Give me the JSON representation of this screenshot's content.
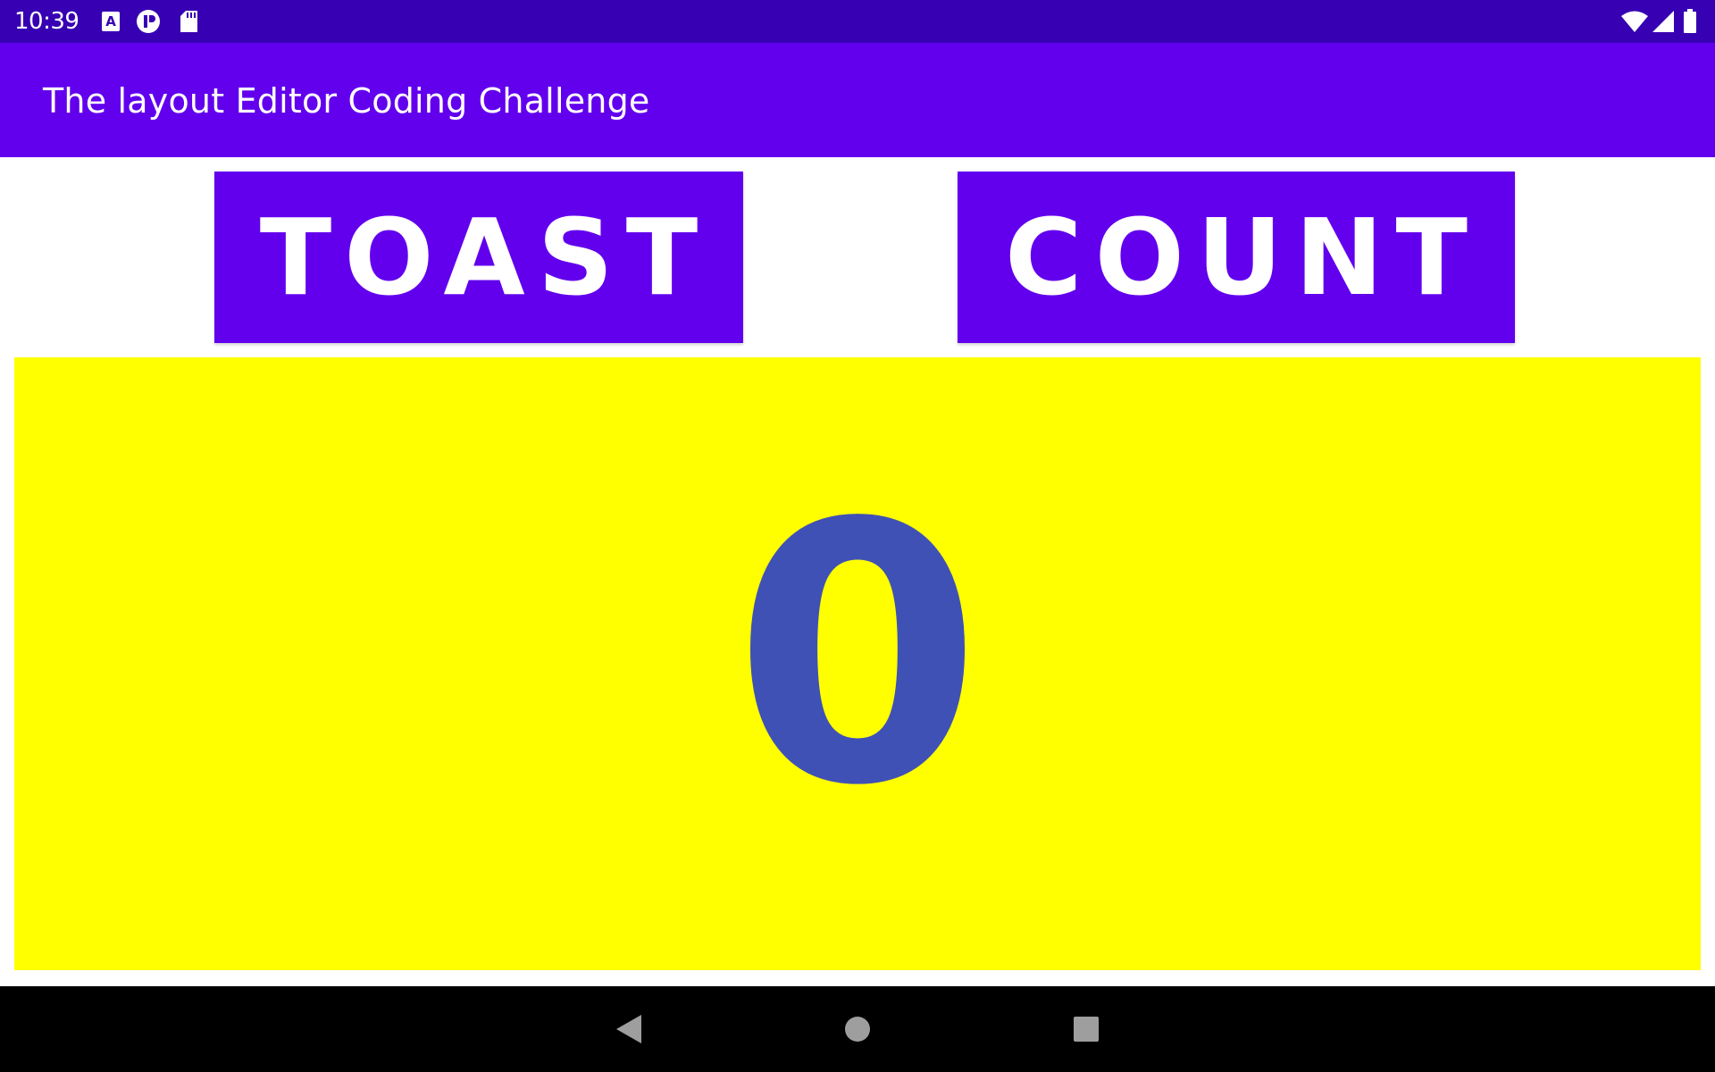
{
  "status_bar": {
    "time": "10:39",
    "background": "#3700b3",
    "left_icons": [
      "text-a-icon",
      "paint-icon",
      "sd-card-icon"
    ],
    "right_icons": [
      "wifi-icon",
      "cellular-icon",
      "battery-icon"
    ]
  },
  "app_bar": {
    "title": "The layout Editor Coding Challenge",
    "background": "#6200ee"
  },
  "buttons": {
    "toast_label": "TOAST",
    "count_label": "COUNT",
    "background": "#6200ee"
  },
  "counter": {
    "value": "0",
    "background": "#ffff00",
    "text_color": "#3f51b5"
  },
  "nav_bar": {
    "buttons": [
      "back-icon",
      "home-icon",
      "recents-icon"
    ]
  }
}
